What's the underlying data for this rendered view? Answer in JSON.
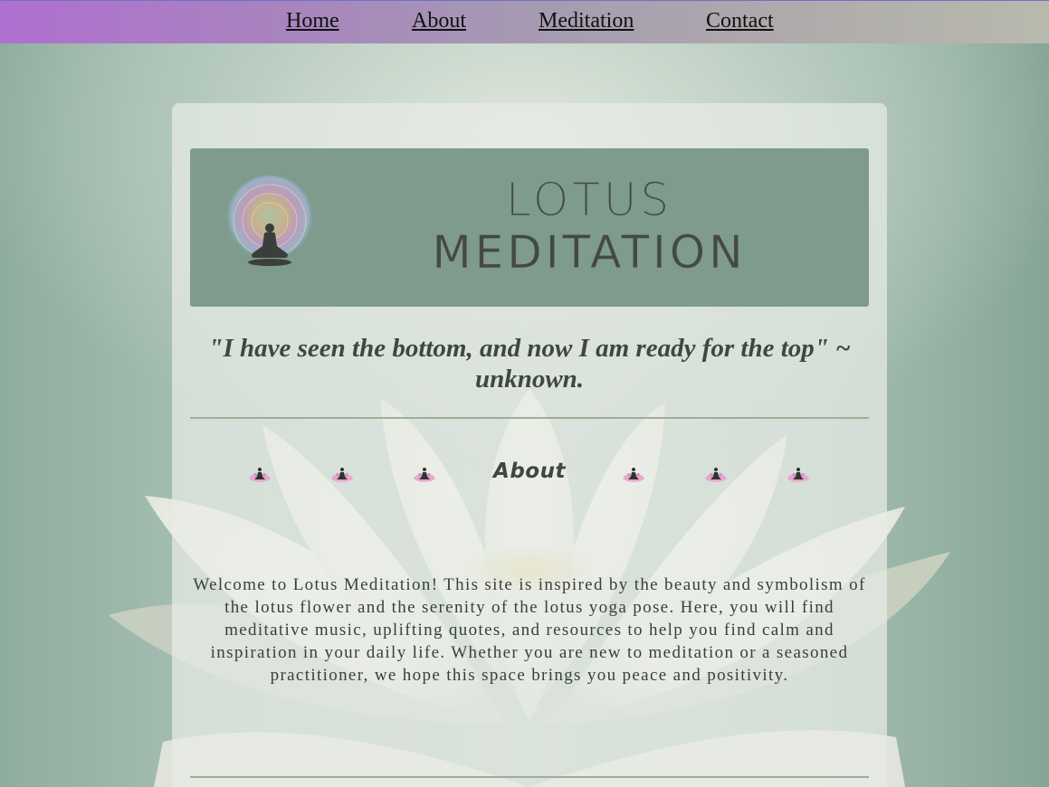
{
  "nav": {
    "items": [
      {
        "label": "Home"
      },
      {
        "label": "About"
      },
      {
        "label": "Meditation"
      },
      {
        "label": "Contact"
      }
    ]
  },
  "banner": {
    "title_line1": "LOTUS",
    "title_line2": "MEDITATION",
    "logo_icon": "meditating-figure-mandala-icon"
  },
  "quote": {
    "text": "\"I have seen the bottom, and now I am ready for the top\" ~ unknown."
  },
  "about": {
    "heading": "About",
    "decoration_icon": "lotus-meditation-icon",
    "body": "Welcome to Lotus Meditation! This site is inspired by the beauty and symbolism of the lotus flower and the serenity of the lotus yoga pose. Here, you will find meditative music, uplifting quotes, and resources to help you find calm and inspiration in your daily life. Whether you are new to meditation or a seasoned practitioner, we hope this space brings you peace and positivity."
  },
  "colors": {
    "nav_gradient_start": "#b06fd0",
    "nav_gradient_end": "#b9b9ad",
    "banner_bg": "#7e9b8d",
    "text_dark": "#3f4741",
    "rule": "#9eae97"
  }
}
